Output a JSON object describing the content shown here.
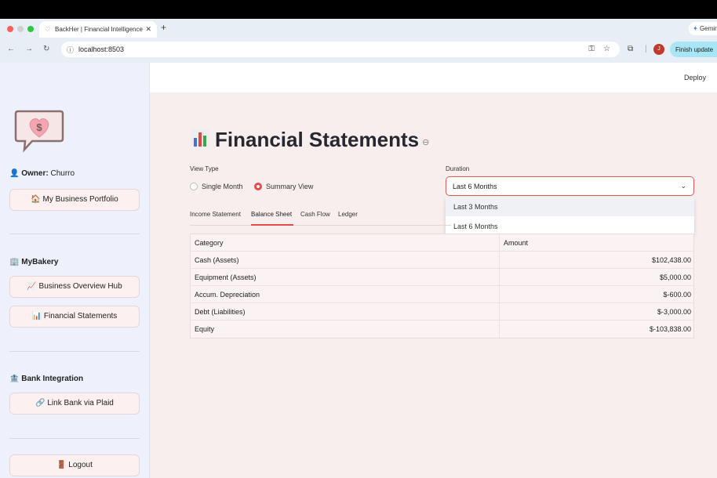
{
  "browser": {
    "tab_title": "BackHer | Financial Intelligence",
    "url": "localhost:8503",
    "gemini_label": "Gemini",
    "avatar_letter": "J",
    "update_label": "Finish update"
  },
  "header": {
    "deploy_label": "Deploy"
  },
  "sidebar": {
    "owner_label": "Owner:",
    "owner_name": "Churro",
    "portfolio_button": "🏠 My Business Portfolio",
    "business_heading": "MyBakery",
    "overview_button": "📈 Business Overview Hub",
    "statements_button": "📊 Financial Statements",
    "bank_heading": "Bank Integration",
    "link_bank_button": "🔗 Link Bank via Plaid",
    "logout_button": "🚪 Logout"
  },
  "main": {
    "title": "Financial Statements",
    "view_type_label": "View Type",
    "view_options": [
      "Single Month",
      "Summary View"
    ],
    "selected_view": "Summary View",
    "duration_label": "Duration",
    "duration_value": "Last 6 Months",
    "duration_options": [
      "Last 3 Months",
      "Last 6 Months"
    ],
    "tabs": [
      "Income Statement",
      "Balance Sheet",
      "Cash Flow",
      "Ledger"
    ],
    "active_tab": "Balance Sheet",
    "table": {
      "headers": [
        "Category",
        "Amount"
      ],
      "rows": [
        [
          "Cash (Assets)",
          "$102,438.00"
        ],
        [
          "Equipment (Assets)",
          "$5,000.00"
        ],
        [
          "Accum. Depreciation",
          "$-600.00"
        ],
        [
          "Debt (Liabilities)",
          "$-3,000.00"
        ],
        [
          "Equity",
          "$-103,838.00"
        ]
      ]
    }
  },
  "colors": {
    "accent": "#e74c4c",
    "main_bg": "#f9eeee",
    "sidebar_bg": "#eef0fb"
  }
}
